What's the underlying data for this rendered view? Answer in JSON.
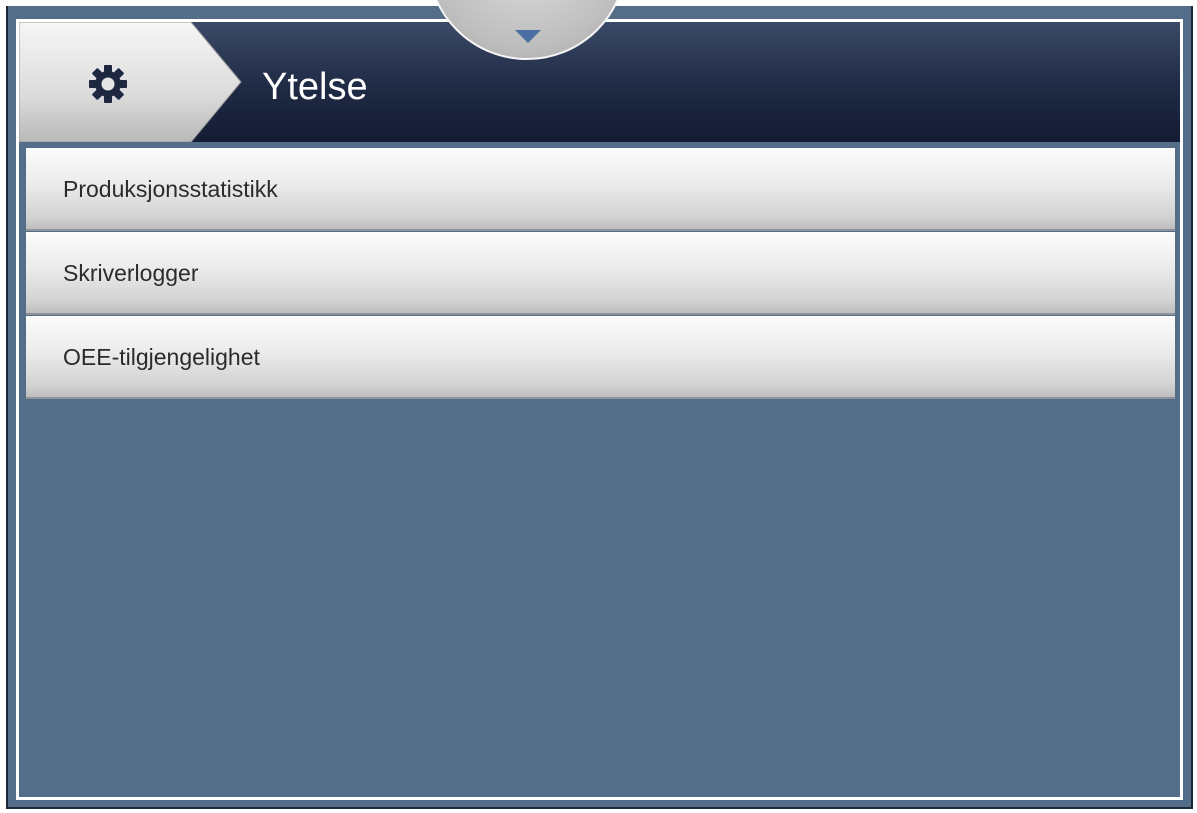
{
  "header": {
    "title": "Ytelse",
    "home_icon": "gear-icon",
    "pulldown_icon": "chevron-down-icon"
  },
  "menu": {
    "items": [
      {
        "label": "Produksjonsstatistikk"
      },
      {
        "label": "Skriverlogger"
      },
      {
        "label": "OEE-tilgjengelighet"
      }
    ]
  },
  "colors": {
    "background": "#546e8a",
    "header": "#1f2a44",
    "accent": "#4a6fa5"
  }
}
